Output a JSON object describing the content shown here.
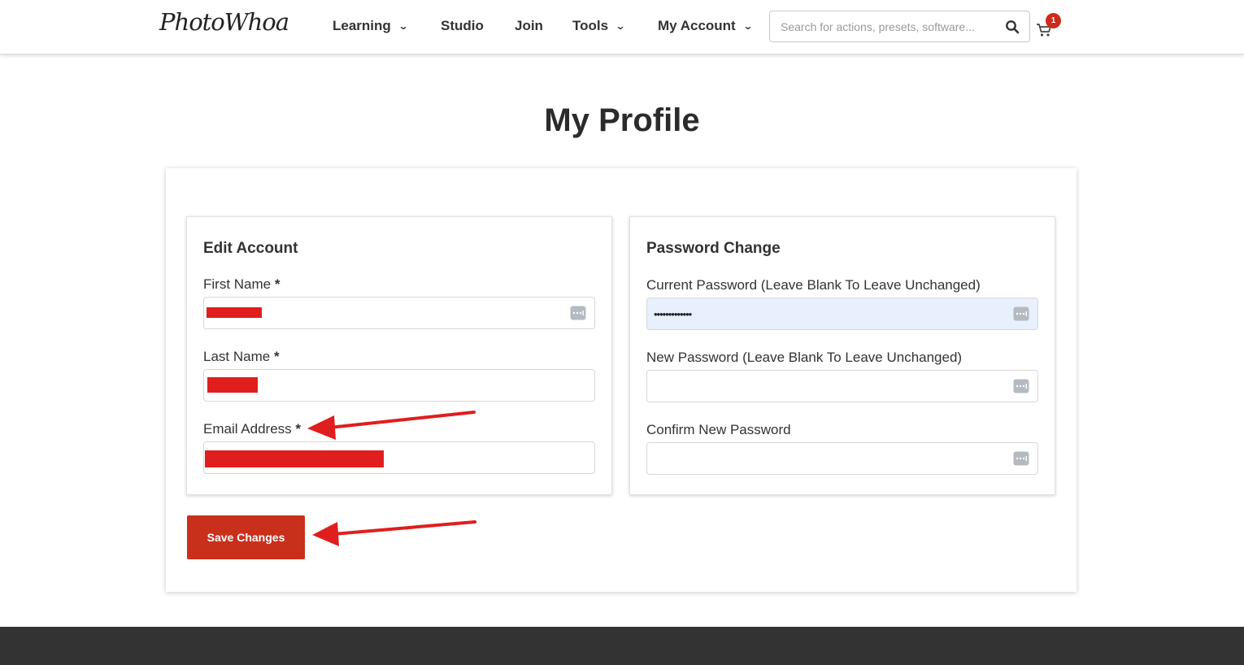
{
  "header": {
    "logo": "PhotoWhoa",
    "nav": [
      {
        "label": "Learning"
      },
      {
        "label": "Studio"
      },
      {
        "label": "Join"
      },
      {
        "label": "Tools"
      },
      {
        "label": "My Account"
      }
    ],
    "search_placeholder": "Search for actions, presets, software...",
    "cart_count": "1"
  },
  "page": {
    "title": "My Profile"
  },
  "edit_account": {
    "title": "Edit Account",
    "first_name_label": "First Name",
    "last_name_label": "Last Name",
    "email_label": "Email Address",
    "required_marker": "*"
  },
  "password_change": {
    "title": "Password Change",
    "current_label": "Current Password (Leave Blank To Leave Unchanged)",
    "current_value": "•••••••••••••",
    "new_label": "New Password (Leave Blank To Leave Unchanged)",
    "confirm_label": "Confirm New Password"
  },
  "actions": {
    "save_label": "Save Changes"
  },
  "colors": {
    "accent": "#c9301c",
    "annotation_arrow": "#e01e1e",
    "footer": "#333333",
    "autofill": "#e8f0fe"
  }
}
